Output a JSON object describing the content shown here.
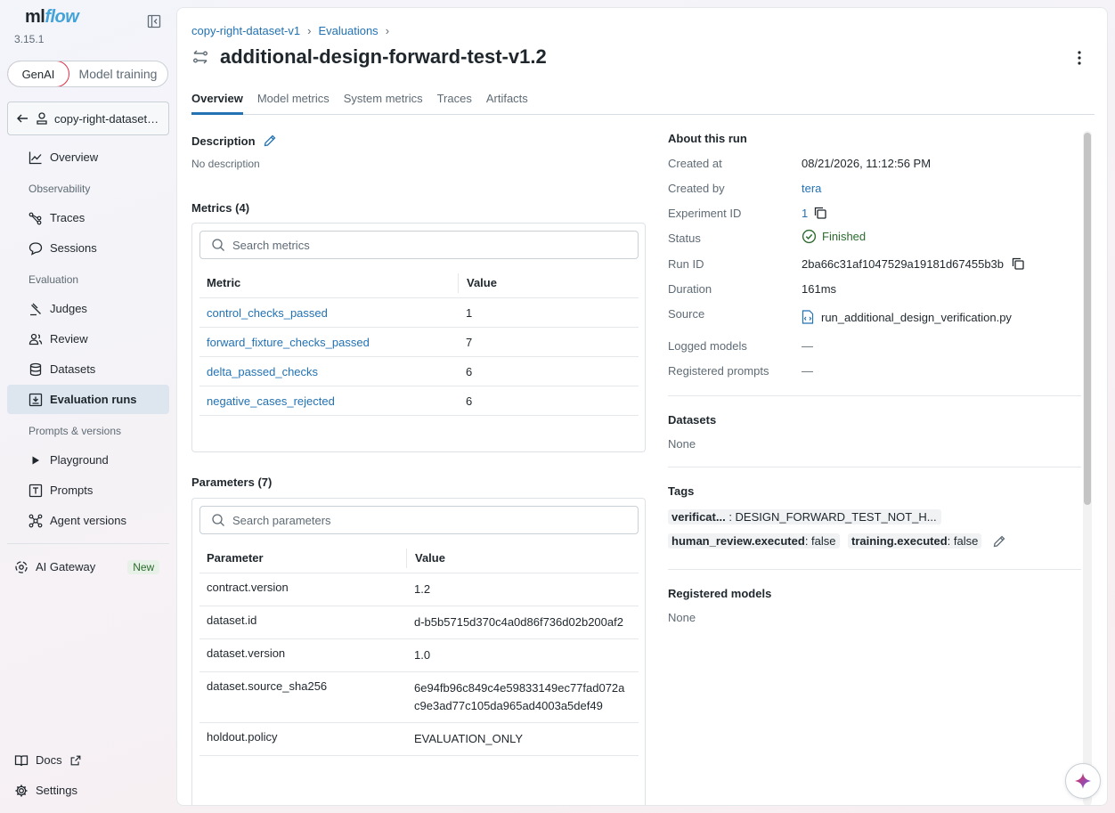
{
  "sidebar": {
    "logo_ml": "ml",
    "logo_flow": "flow",
    "version": "3.15.1",
    "mode_genai": "GenAI",
    "mode_training": "Model training",
    "experiment_name": "copy-right-dataset-v1",
    "overview": "Overview",
    "section_observability": "Observability",
    "traces": "Traces",
    "sessions": "Sessions",
    "section_evaluation": "Evaluation",
    "judges": "Judges",
    "review": "Review",
    "datasets": "Datasets",
    "evaluation_runs": "Evaluation runs",
    "section_prompts": "Prompts & versions",
    "playground": "Playground",
    "prompts": "Prompts",
    "agent_versions": "Agent versions",
    "ai_gateway": "AI Gateway",
    "new_badge": "New",
    "docs": "Docs",
    "settings": "Settings"
  },
  "header": {
    "breadcrumb_experiment": "copy-right-dataset-v1",
    "breadcrumb_evaluations": "Evaluations",
    "sep": "›",
    "title": "additional-design-forward-test-v1.2"
  },
  "tabs": [
    "Overview",
    "Model metrics",
    "System metrics",
    "Traces",
    "Artifacts"
  ],
  "description": {
    "label": "Description",
    "value": "No description"
  },
  "metrics": {
    "label": "Metrics (4)",
    "search_placeholder": "Search metrics",
    "col_metric": "Metric",
    "col_value": "Value",
    "rows": [
      {
        "name": "control_checks_passed",
        "value": "1"
      },
      {
        "name": "forward_fixture_checks_passed",
        "value": "7"
      },
      {
        "name": "delta_passed_checks",
        "value": "6"
      },
      {
        "name": "negative_cases_rejected",
        "value": "6"
      }
    ]
  },
  "parameters": {
    "label": "Parameters (7)",
    "search_placeholder": "Search parameters",
    "col_param": "Parameter",
    "col_value": "Value",
    "rows": [
      {
        "name": "contract.version",
        "value": "1.2"
      },
      {
        "name": "dataset.id",
        "value": "d-b5b5715d370c4a0d86f736d02b200af2"
      },
      {
        "name": "dataset.version",
        "value": "1.0"
      },
      {
        "name": "dataset.source_sha256",
        "value": "6e94fb96c849c4e59833149ec77fad072ac9e3ad77c105da965ad4003a5def49"
      },
      {
        "name": "holdout.policy",
        "value": "EVALUATION_ONLY"
      }
    ]
  },
  "about": {
    "label": "About this run",
    "created_at_k": "Created at",
    "created_at_v": "08/21/2026, 11:12:56 PM",
    "created_by_k": "Created by",
    "created_by_v": "tera",
    "experiment_id_k": "Experiment ID",
    "experiment_id_v": "1",
    "status_k": "Status",
    "status_v": "Finished",
    "run_id_k": "Run ID",
    "run_id_v": "2ba66c31af1047529a19181d67455b3b",
    "duration_k": "Duration",
    "duration_v": "161ms",
    "source_k": "Source",
    "source_v": "run_additional_design_verification.py",
    "logged_models_k": "Logged models",
    "logged_models_v": "—",
    "registered_prompts_k": "Registered prompts",
    "registered_prompts_v": "—"
  },
  "datasets": {
    "label": "Datasets",
    "value": "None"
  },
  "tags": {
    "label": "Tags",
    "tag1_k": "verificat...",
    "tag1_v": " : DESIGN_FORWARD_TEST_NOT_H...",
    "tag2_k": "human_review.executed",
    "tag2_v": ": false",
    "tag3_k": "training.executed",
    "tag3_v": ": false"
  },
  "registered_models": {
    "label": "Registered models",
    "value": "None"
  },
  "colors": {
    "accent": "#2272b4",
    "success": "#2d6b2f",
    "brand_red": "#e0304b"
  }
}
